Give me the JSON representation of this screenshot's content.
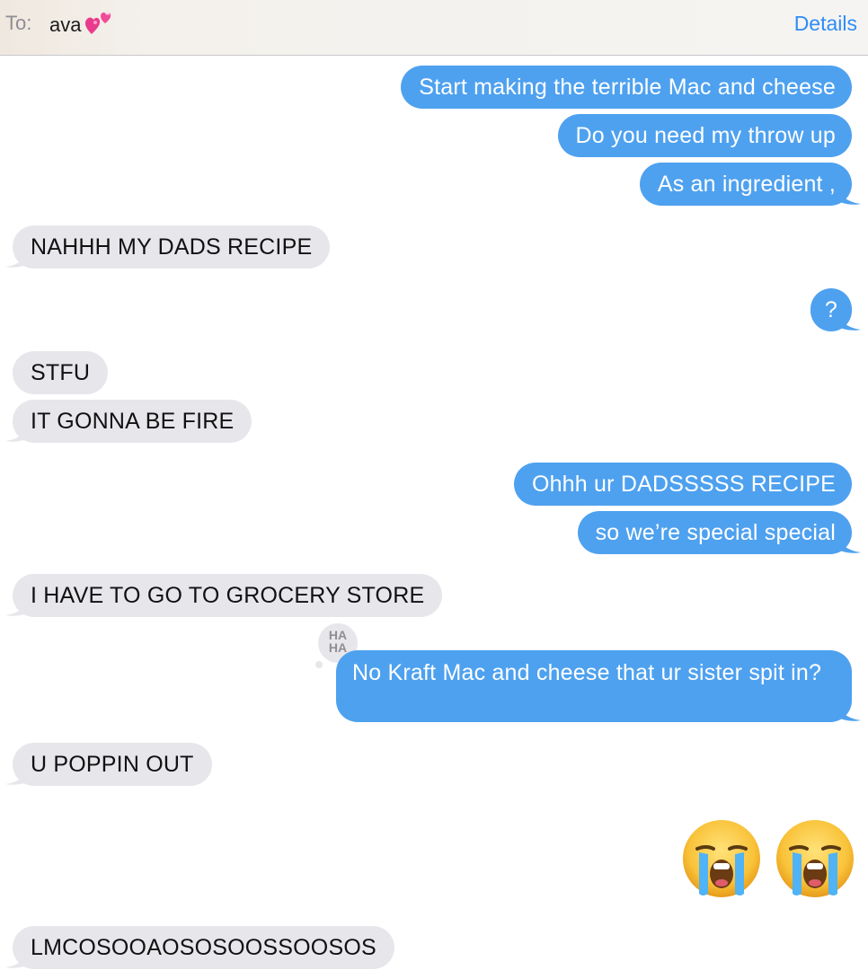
{
  "header": {
    "to_label": "To:",
    "recipient": "ava",
    "recipient_emoji": "two-hearts-icon",
    "details_label": "Details"
  },
  "messages": [
    {
      "from": "me",
      "text": "Start making the terrible Mac and cheese"
    },
    {
      "from": "me",
      "text": "Do you need my throw up"
    },
    {
      "from": "me",
      "text": "As an ingredient ,"
    },
    {
      "from": "them",
      "text": "NAHHH MY DADS RECIPE"
    },
    {
      "from": "me",
      "text": "?"
    },
    {
      "from": "them",
      "text": "STFU"
    },
    {
      "from": "them",
      "text": "IT GONNA BE FIRE"
    },
    {
      "from": "me",
      "text": "Ohhh ur DADSSSSS RECIPE"
    },
    {
      "from": "me",
      "text": "so we’re special special"
    },
    {
      "from": "them",
      "text": "I HAVE TO GO TO GROCERY STORE"
    },
    {
      "from": "me",
      "text": "No Kraft Mac and cheese that ur sister spit in?",
      "tapback": "HA HA"
    },
    {
      "from": "them",
      "text": "U POPPIN OUT"
    },
    {
      "from": "me",
      "emoji": [
        "loudly-crying-face-icon",
        "loudly-crying-face-icon"
      ]
    },
    {
      "from": "them",
      "text": "LMCOSOOAOSOSOOSSOOSOS"
    }
  ],
  "colors": {
    "outgoing_bubble": "#4ea1ef",
    "incoming_bubble": "#e7e6eb",
    "link_blue": "#2f8cf5"
  }
}
